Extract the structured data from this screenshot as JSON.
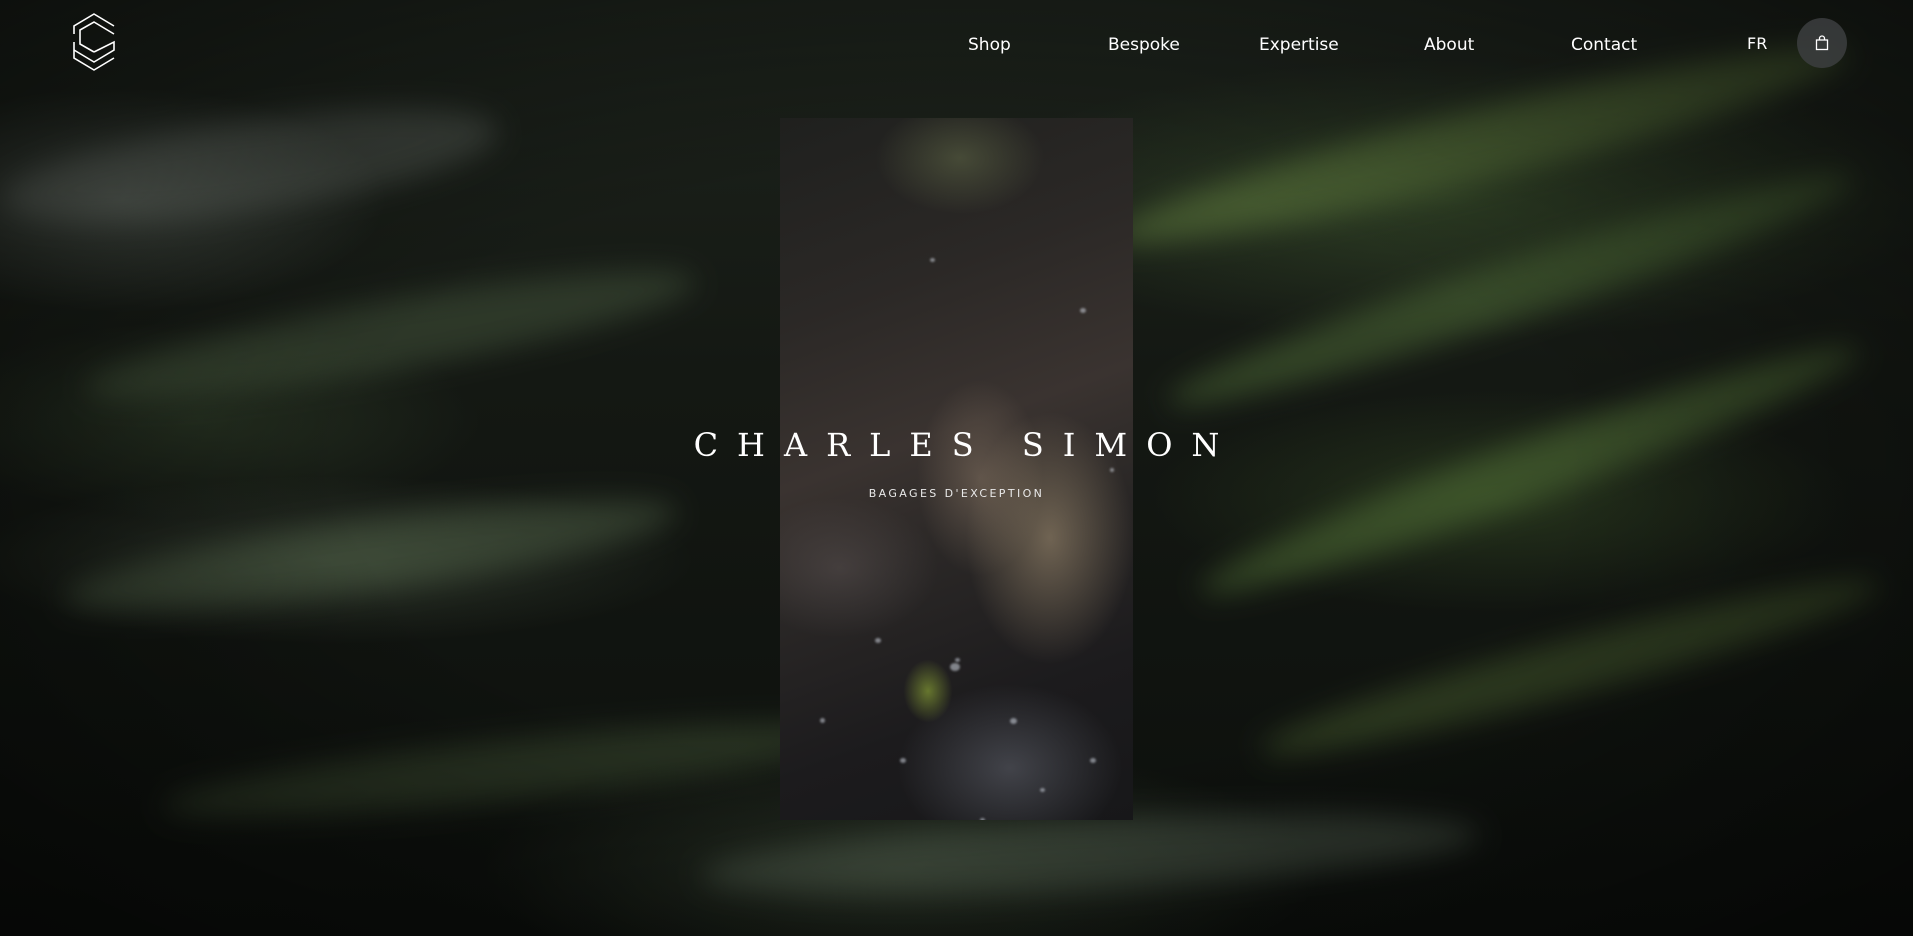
{
  "brand": {
    "name": "CHARLES SIMON",
    "tagline": "BAGAGES D'EXCEPTION",
    "logo_icon": "charles-simon-logo-icon"
  },
  "nav": {
    "items": [
      {
        "label": "Shop"
      },
      {
        "label": "Bespoke"
      },
      {
        "label": "Expertise"
      },
      {
        "label": "About"
      },
      {
        "label": "Contact"
      }
    ],
    "language": "FR",
    "cart_icon": "shopping-bag-icon"
  },
  "colors": {
    "text": "#ffffff",
    "cart_button_bg": "#3c3e40"
  }
}
